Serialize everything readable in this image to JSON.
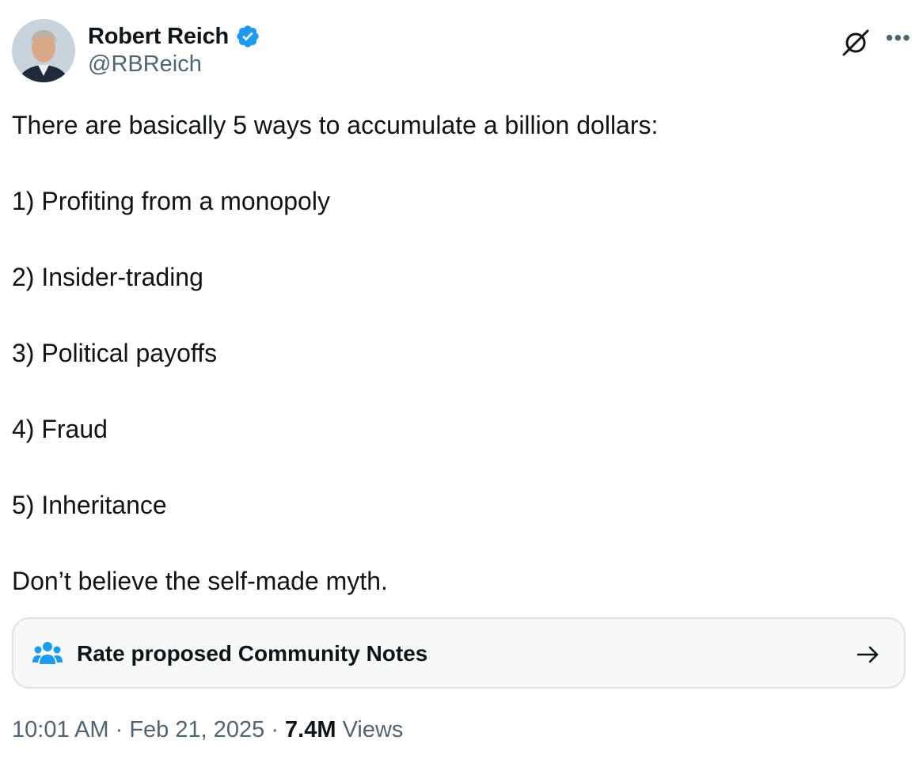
{
  "author": {
    "display_name": "Robert Reich",
    "handle": "@RBReich",
    "verified": true,
    "avatar_icon": "profile-photo"
  },
  "icons": {
    "grok": "grok-icon",
    "more": "more-icon",
    "verified": "verified-badge-icon",
    "community_notes": "people-icon",
    "arrow": "arrow-right-icon"
  },
  "tweet": {
    "lines": [
      "There are basically 5 ways to accumulate a billion dollars:",
      "1) Profiting from a monopoly",
      "2) Insider-trading",
      "3) Political payoffs",
      "4) Fraud",
      "5) Inheritance",
      "Don’t believe the self-made myth."
    ]
  },
  "community_notes": {
    "label": "Rate proposed Community Notes"
  },
  "meta": {
    "time": "10:01 AM",
    "separator": "·",
    "date": "Feb 21, 2025",
    "views_count": "7.4M",
    "views_label": "Views"
  },
  "colors": {
    "text": "#0f1419",
    "secondary": "#536471",
    "verified_blue": "#1d9bf0",
    "card_bg": "#f7f9f9",
    "card_border": "#dfe3e7"
  }
}
